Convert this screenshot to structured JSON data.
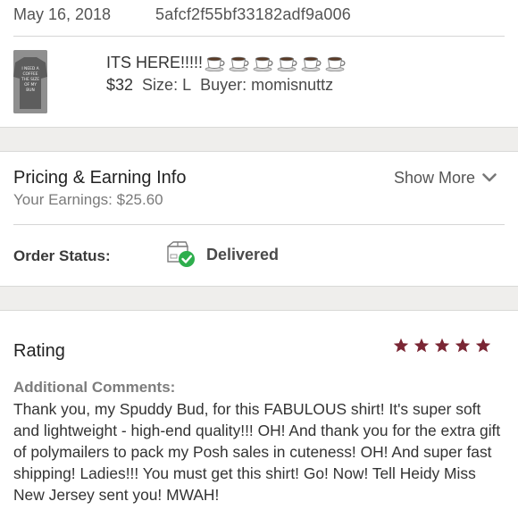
{
  "order": {
    "date": "May 16, 2018",
    "id": "5afcf2f55bf33182adf9a006"
  },
  "item": {
    "title": "ITS HERE!!!!!",
    "emoji_icons": [
      "coffee-cup-icon",
      "coffee-cup-icon",
      "coffee-cup-icon",
      "coffee-cup-icon",
      "coffee-cup-icon",
      "coffee-cup-icon"
    ],
    "price": "$32",
    "size": "Size: L",
    "buyer": "Buyer: momisnuttz",
    "thumbnail_text": [
      "I NEED A",
      "COFFEE",
      "THE SIZE",
      "OF MY",
      "BUN"
    ]
  },
  "pricing": {
    "title": "Pricing & Earning Info",
    "earnings": "Your Earnings: $25.60",
    "show_more": "Show More"
  },
  "status": {
    "label": "Order Status:",
    "value": "Delivered",
    "icon": "package-check-icon"
  },
  "rating": {
    "title": "Rating",
    "stars": 5,
    "max_stars": 5,
    "star_color": "#7a2634",
    "comments_label": "Additional Comments:",
    "comments": "Thank you, my Spuddy Bud, for this FABULOUS shirt! It's super soft and lightweight - high-end quality!!! OH! And thank you for the extra gift of polymailers to pack my Posh sales in cuteness! OH! And super fast shipping! Ladies!!! You must get this shirt! Go! Now! Tell Heidy Miss New Jersey sent you! MWAH!"
  },
  "colors": {
    "accent_green": "#2eae4d",
    "section_band": "#efeeec"
  }
}
